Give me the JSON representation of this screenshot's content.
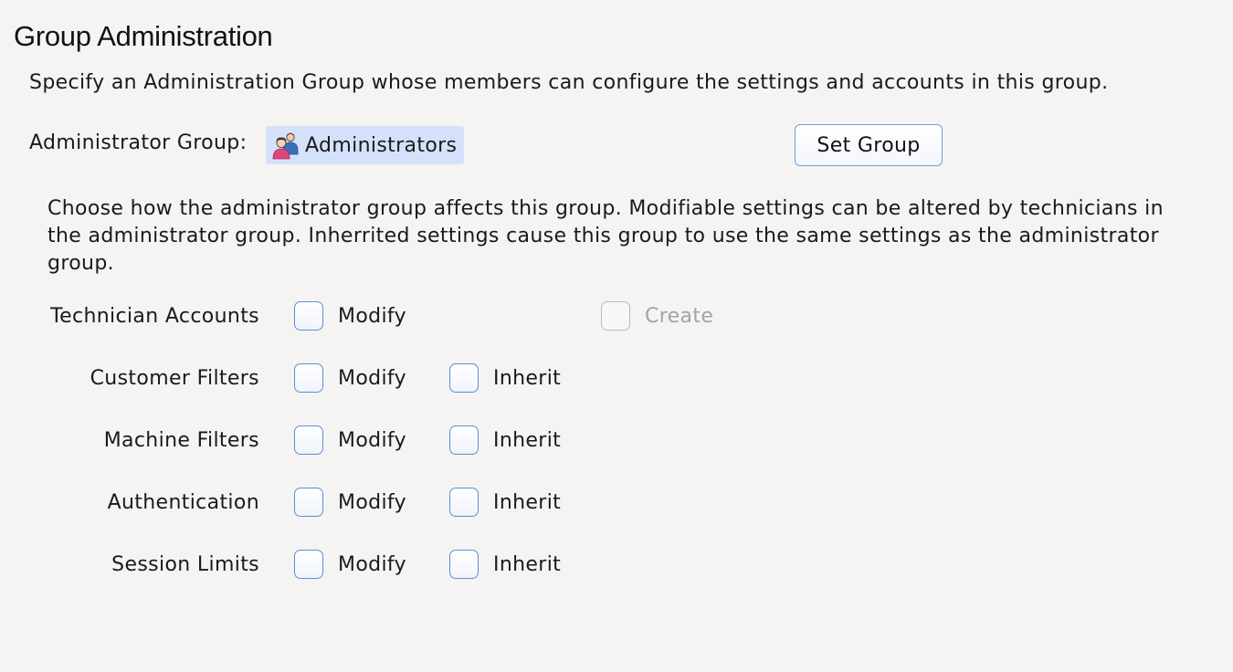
{
  "page": {
    "title": "Group Administration",
    "description": "Specify an Administration Group whose members can configure the settings and accounts in this group."
  },
  "admin_group": {
    "label": "Administrator Group:",
    "value": "Administrators",
    "icon": "users-icon",
    "set_button_label": "Set Group"
  },
  "explanation": {
    "lines": [
      "Choose how the administrator group affects this group. Modifiable settings can be altered by technicians in",
      "the administrator group. Inherrited settings cause this group to use the same settings as the administrator",
      "group."
    ]
  },
  "permissions": [
    {
      "label": "Technician Accounts",
      "modify_label": "Modify",
      "modify_checked": false,
      "extra_label": "Create",
      "extra_checked": false,
      "extra_enabled": false
    },
    {
      "label": "Customer Filters",
      "modify_label": "Modify",
      "modify_checked": false,
      "inherit_label": "Inherit",
      "inherit_checked": false
    },
    {
      "label": "Machine Filters",
      "modify_label": "Modify",
      "modify_checked": false,
      "inherit_label": "Inherit",
      "inherit_checked": false
    },
    {
      "label": "Authentication",
      "modify_label": "Modify",
      "modify_checked": false,
      "inherit_label": "Inherit",
      "inherit_checked": false
    },
    {
      "label": "Session Limits",
      "modify_label": "Modify",
      "modify_checked": false,
      "inherit_label": "Inherit",
      "inherit_checked": false
    }
  ],
  "colors": {
    "background": "#f5f4f3",
    "chip_background": "#d5e1fb",
    "checkbox_border": "#5b8fd6",
    "disabled_text": "#a3a3a3"
  }
}
